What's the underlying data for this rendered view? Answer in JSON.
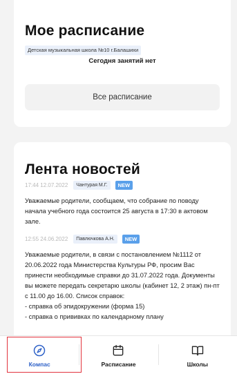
{
  "schedule": {
    "title": "Мое расписание",
    "school": "Детская музыкальная школа №10 г.Балашихи",
    "empty_text": "Сегодня занятий нет",
    "all_button": "Все расписание"
  },
  "news": {
    "title": "Лента новостей",
    "items": [
      {
        "time": "17:44 12.07.2022",
        "author": "Чантурая М.Г.",
        "badge": "NEW",
        "text": "Уважаемые родители, сообщаем, что собрание по поводу начала учебного года состоится 25 августа в 17:30 в актовом зале."
      },
      {
        "time": "12:55 24.06.2022",
        "author": "Павлючкова А.Н.",
        "badge": "NEW",
        "text": "Уважаемые родители, в связи с постановлением №1112 от 20.06.2022 года Министерства Культуры РФ, просим Вас принести необходимые справки до 31.07.2022 года. Документы вы можете передать секретарю школы (кабинет 12, 2 этаж) пн-пт с 11.00 до 16.00. Список справок:\n- справка об эпидокружении (форма 15)\n- справка о прививках по календарному плану"
      }
    ]
  },
  "tabbar": {
    "tabs": [
      {
        "label": "Компас",
        "icon": "compass-icon",
        "active": true
      },
      {
        "label": "Расписание",
        "icon": "calendar-icon",
        "active": false
      },
      {
        "label": "Школы",
        "icon": "book-icon",
        "active": false
      }
    ]
  },
  "colors": {
    "accent": "#2f62c8",
    "badge_new": "#5aa0ea",
    "highlight": "#e2323c"
  }
}
